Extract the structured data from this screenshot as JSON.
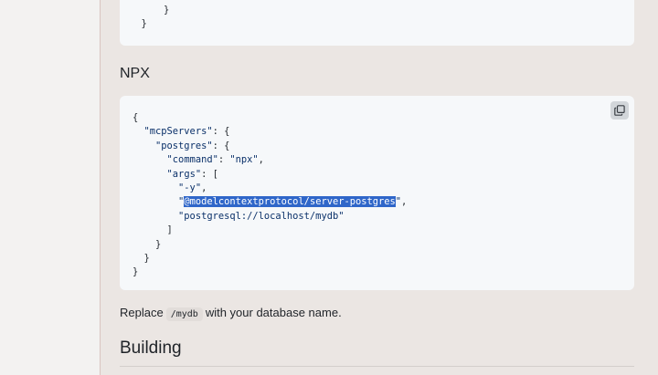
{
  "top_code_tail": {
    "line1": "    }",
    "line2": "  }"
  },
  "npx_section": {
    "heading": "NPX",
    "code": {
      "l1": "{",
      "l2_key": "\"mcpServers\"",
      "l2_rest": ": {",
      "l3_key": "\"postgres\"",
      "l3_rest": ": {",
      "l4_key": "\"command\"",
      "l4_sep": ": ",
      "l4_val": "\"npx\"",
      "l4_end": ",",
      "l5_key": "\"args\"",
      "l5_rest": ": [",
      "l6_val": "\"-y\"",
      "l6_end": ",",
      "l7_q1": "\"",
      "l7_highlight": "@modelcontextprotocol/server-postgres",
      "l7_q2": "\"",
      "l7_end": ",",
      "l8_val": "\"postgresql://localhost/mydb\"",
      "l9": "]",
      "l10": "}",
      "l11": "}",
      "l12": "}"
    },
    "copy_icon": "copy-icon"
  },
  "replace_para": {
    "before": "Replace",
    "code": "/mydb",
    "after": "with your database name."
  },
  "building_heading": "Building"
}
